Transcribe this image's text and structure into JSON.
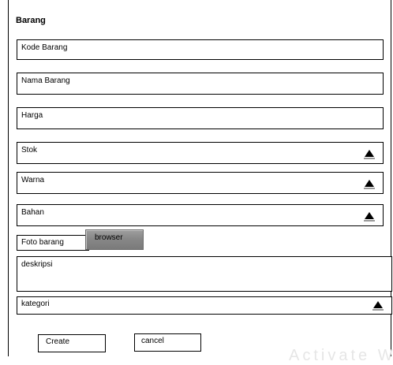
{
  "form": {
    "title": "Barang",
    "fields": {
      "kode_barang": "Kode Barang",
      "nama_barang": "Nama Barang",
      "harga": "Harga",
      "stok": "Stok",
      "warna": "Warna",
      "bahan": "Bahan",
      "foto_barang": "Foto barang",
      "deskripsi": "deskripsi",
      "kategori": "kategori"
    },
    "browse_label": "browser",
    "create_label": "Create",
    "cancel_label": "cancel"
  },
  "icons": {
    "dropdown": "triangle-up-icon"
  },
  "watermark": "Activate Wi"
}
